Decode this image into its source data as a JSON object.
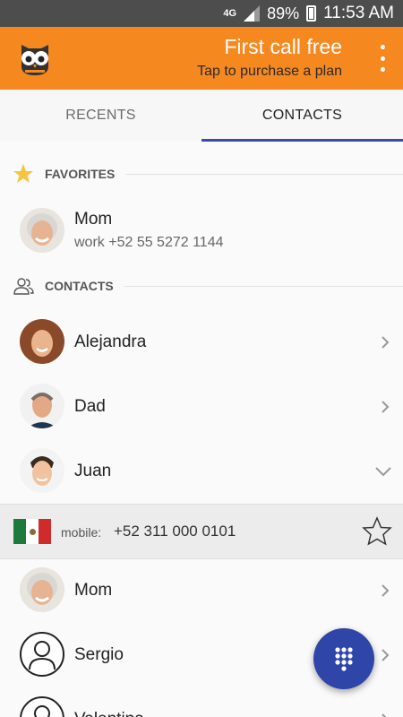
{
  "status_bar": {
    "network": "4G",
    "battery": "89%",
    "time": "11:53 AM"
  },
  "promo": {
    "title": "First call free",
    "subtitle": "Tap to purchase a plan"
  },
  "tabs": [
    {
      "label": "RECENTS"
    },
    {
      "label": "CONTACTS",
      "active": true
    }
  ],
  "favorites": {
    "header": "FAVORITES",
    "items": [
      {
        "name": "Mom",
        "detail": "work   +52 55 5272 1144"
      }
    ]
  },
  "contacts": {
    "header": "CONTACTS",
    "items": [
      {
        "name": "Alejandra"
      },
      {
        "name": "Dad"
      },
      {
        "name": "Juan",
        "expanded": true
      },
      {
        "name": "Mom"
      },
      {
        "name": "Sergio"
      },
      {
        "name": "Valentina"
      }
    ]
  },
  "expanded_detail": {
    "type_label": "mobile:",
    "number": "+52 311 000 0101"
  },
  "colors": {
    "appbar": "#f5891f",
    "tab_indicator": "#3a4aa8",
    "fab": "#2f45a8"
  },
  "icons": {
    "logo": "owl-logo-icon",
    "menu": "overflow-menu-icon",
    "favorites": "star-icon",
    "contacts": "people-icon",
    "chevron_right": "chevron-right-icon",
    "chevron_down": "chevron-down-icon",
    "favorite_toggle": "star-outline-icon",
    "dialpad": "dialpad-icon",
    "flag": "mexico-flag-icon"
  }
}
